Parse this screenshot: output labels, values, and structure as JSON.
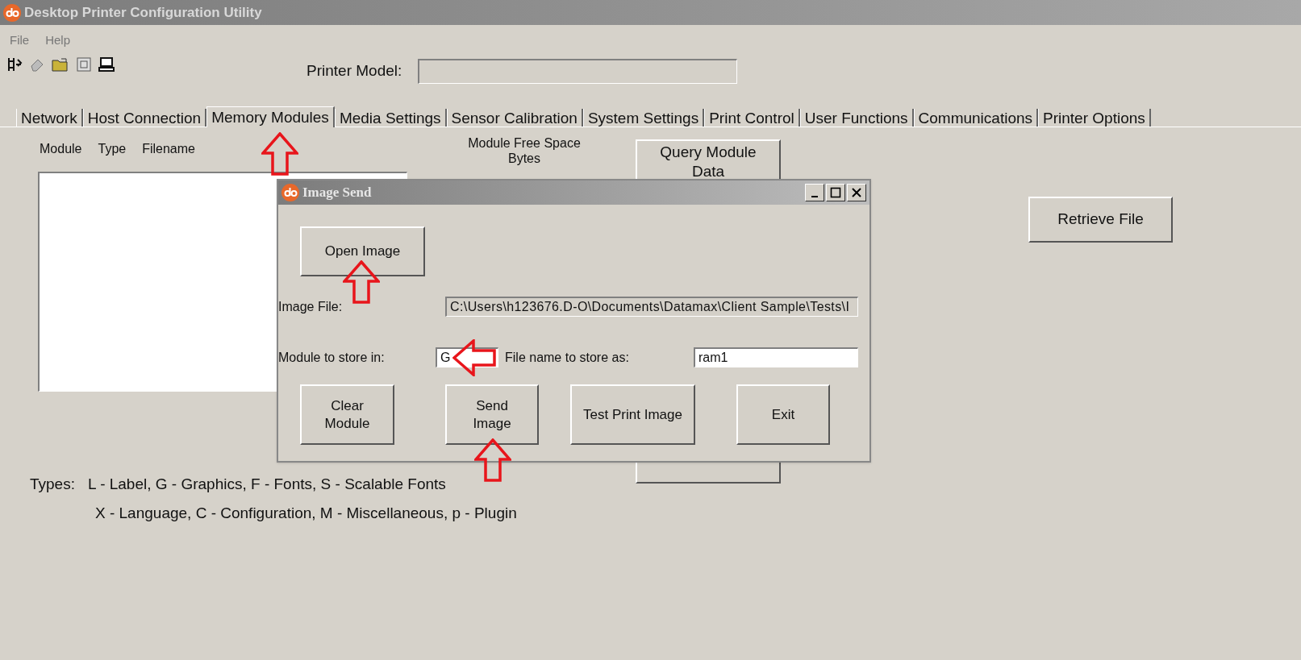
{
  "window": {
    "title": "Desktop Printer Configuration Utility"
  },
  "menu": [
    "File",
    "Help"
  ],
  "printer_model": {
    "label": "Printer Model:"
  },
  "tabs": [
    {
      "label": "Network",
      "selected": false
    },
    {
      "label": "Host Connection",
      "selected": false
    },
    {
      "label": "Memory Modules",
      "selected": true
    },
    {
      "label": "Media Settings",
      "selected": false
    },
    {
      "label": "Sensor Calibration",
      "selected": false
    },
    {
      "label": "System Settings",
      "selected": false
    },
    {
      "label": "Print Control",
      "selected": false
    },
    {
      "label": "User Functions",
      "selected": false
    },
    {
      "label": "Communications",
      "selected": false
    },
    {
      "label": "Printer Options",
      "selected": false
    }
  ],
  "module_list": {
    "columns": [
      "Module",
      "Type",
      "Filename"
    ]
  },
  "free_space_header": "Module Free Space Bytes",
  "buttons": {
    "query": "Query Module Data",
    "retrieve": "Retrieve File"
  },
  "types_legend": [
    "Types:",
    "L - Label, G - Graphics, F - Fonts, S - Scalable Fonts",
    "X - Language, C - Configuration, M - Miscellaneous, p - Plugin"
  ],
  "dialog": {
    "title": "Image Send",
    "open_button": "Open Image",
    "image_file_label": "Image File:",
    "image_file_value": "C:\\Users\\h123676.D-O\\Documents\\Datamax\\Client  Sample\\Tests\\I",
    "module_label": "Module to store in:",
    "module_value": "G",
    "file_name_label": "File name to store as:",
    "file_name_value": "ram1",
    "actions": [
      "Clear Module",
      "Send Image",
      "Test Print Image",
      "Exit"
    ]
  }
}
